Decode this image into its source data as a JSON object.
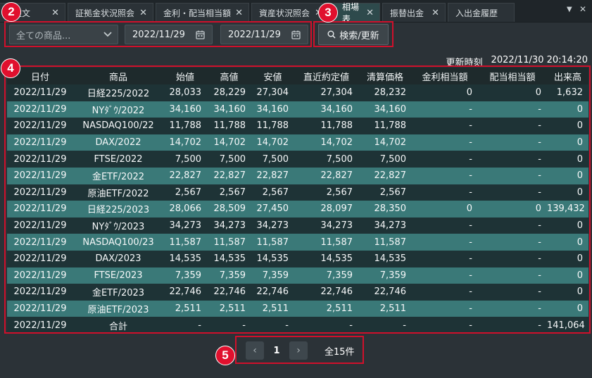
{
  "tabs": [
    {
      "label": "注文"
    },
    {
      "label": "証拠金状況照会"
    },
    {
      "label": "金利・配当相当額"
    },
    {
      "label": "資産状況照会"
    },
    {
      "label": "相場表"
    },
    {
      "label": "振替出金"
    },
    {
      "label": "入出金履歴"
    }
  ],
  "search": {
    "product_placeholder": "全ての商品...",
    "date_from": "2022/11/29",
    "date_to": "2022/11/29",
    "button_label": "検索/更新"
  },
  "update": {
    "label": "更新時刻",
    "value": "2022/11/30 20:14:20"
  },
  "table": {
    "headers": [
      "日付",
      "商品",
      "始値",
      "高値",
      "安値",
      "直近約定値",
      "清算価格",
      "金利相当額",
      "配当相当額",
      "出来高"
    ],
    "rows": [
      [
        "2022/11/29",
        "日経225/2022",
        "28,033",
        "28,229",
        "27,304",
        "27,304",
        "28,232",
        "0",
        "0",
        "1,632"
      ],
      [
        "2022/11/29",
        "NYﾀﾞｳ/2022",
        "34,160",
        "34,160",
        "34,160",
        "34,160",
        "34,160",
        "-",
        "-",
        "0"
      ],
      [
        "2022/11/29",
        "NASDAQ100/22",
        "11,788",
        "11,788",
        "11,788",
        "11,788",
        "11,788",
        "-",
        "-",
        "0"
      ],
      [
        "2022/11/29",
        "DAX/2022",
        "14,702",
        "14,702",
        "14,702",
        "14,702",
        "14,702",
        "-",
        "-",
        "0"
      ],
      [
        "2022/11/29",
        "FTSE/2022",
        "7,500",
        "7,500",
        "7,500",
        "7,500",
        "7,500",
        "-",
        "-",
        "0"
      ],
      [
        "2022/11/29",
        "金ETF/2022",
        "22,827",
        "22,827",
        "22,827",
        "22,827",
        "22,827",
        "-",
        "-",
        "0"
      ],
      [
        "2022/11/29",
        "原油ETF/2022",
        "2,567",
        "2,567",
        "2,567",
        "2,567",
        "2,567",
        "-",
        "-",
        "0"
      ],
      [
        "2022/11/29",
        "日経225/2023",
        "28,066",
        "28,509",
        "27,450",
        "28,097",
        "28,350",
        "0",
        "0",
        "139,432"
      ],
      [
        "2022/11/29",
        "NYﾀﾞｳ/2023",
        "34,273",
        "34,273",
        "34,273",
        "34,273",
        "34,273",
        "-",
        "-",
        "0"
      ],
      [
        "2022/11/29",
        "NASDAQ100/23",
        "11,587",
        "11,587",
        "11,587",
        "11,587",
        "11,587",
        "-",
        "-",
        "0"
      ],
      [
        "2022/11/29",
        "DAX/2023",
        "14,535",
        "14,535",
        "14,535",
        "14,535",
        "14,535",
        "-",
        "-",
        "0"
      ],
      [
        "2022/11/29",
        "FTSE/2023",
        "7,359",
        "7,359",
        "7,359",
        "7,359",
        "7,359",
        "-",
        "-",
        "0"
      ],
      [
        "2022/11/29",
        "金ETF/2023",
        "22,746",
        "22,746",
        "22,746",
        "22,746",
        "22,746",
        "-",
        "-",
        "0"
      ],
      [
        "2022/11/29",
        "原油ETF/2023",
        "2,511",
        "2,511",
        "2,511",
        "2,511",
        "2,511",
        "-",
        "-",
        "0"
      ],
      [
        "2022/11/29",
        "合計",
        "-",
        "-",
        "-",
        "-",
        "-",
        "-",
        "-",
        "141,064"
      ]
    ]
  },
  "pager": {
    "prev": "‹",
    "page": "1",
    "next": "›",
    "total": "全15件"
  },
  "badges": [
    "2",
    "3",
    "4",
    "5"
  ],
  "colors": {
    "accent": "#d0102b",
    "row_dark": "#1e3336",
    "row_teal": "#3a7978",
    "active_tab": "#2e4a4c"
  },
  "icons": [
    "close-icon",
    "chevron-down-icon",
    "calendar-icon",
    "search-icon",
    "window-close-icon"
  ]
}
